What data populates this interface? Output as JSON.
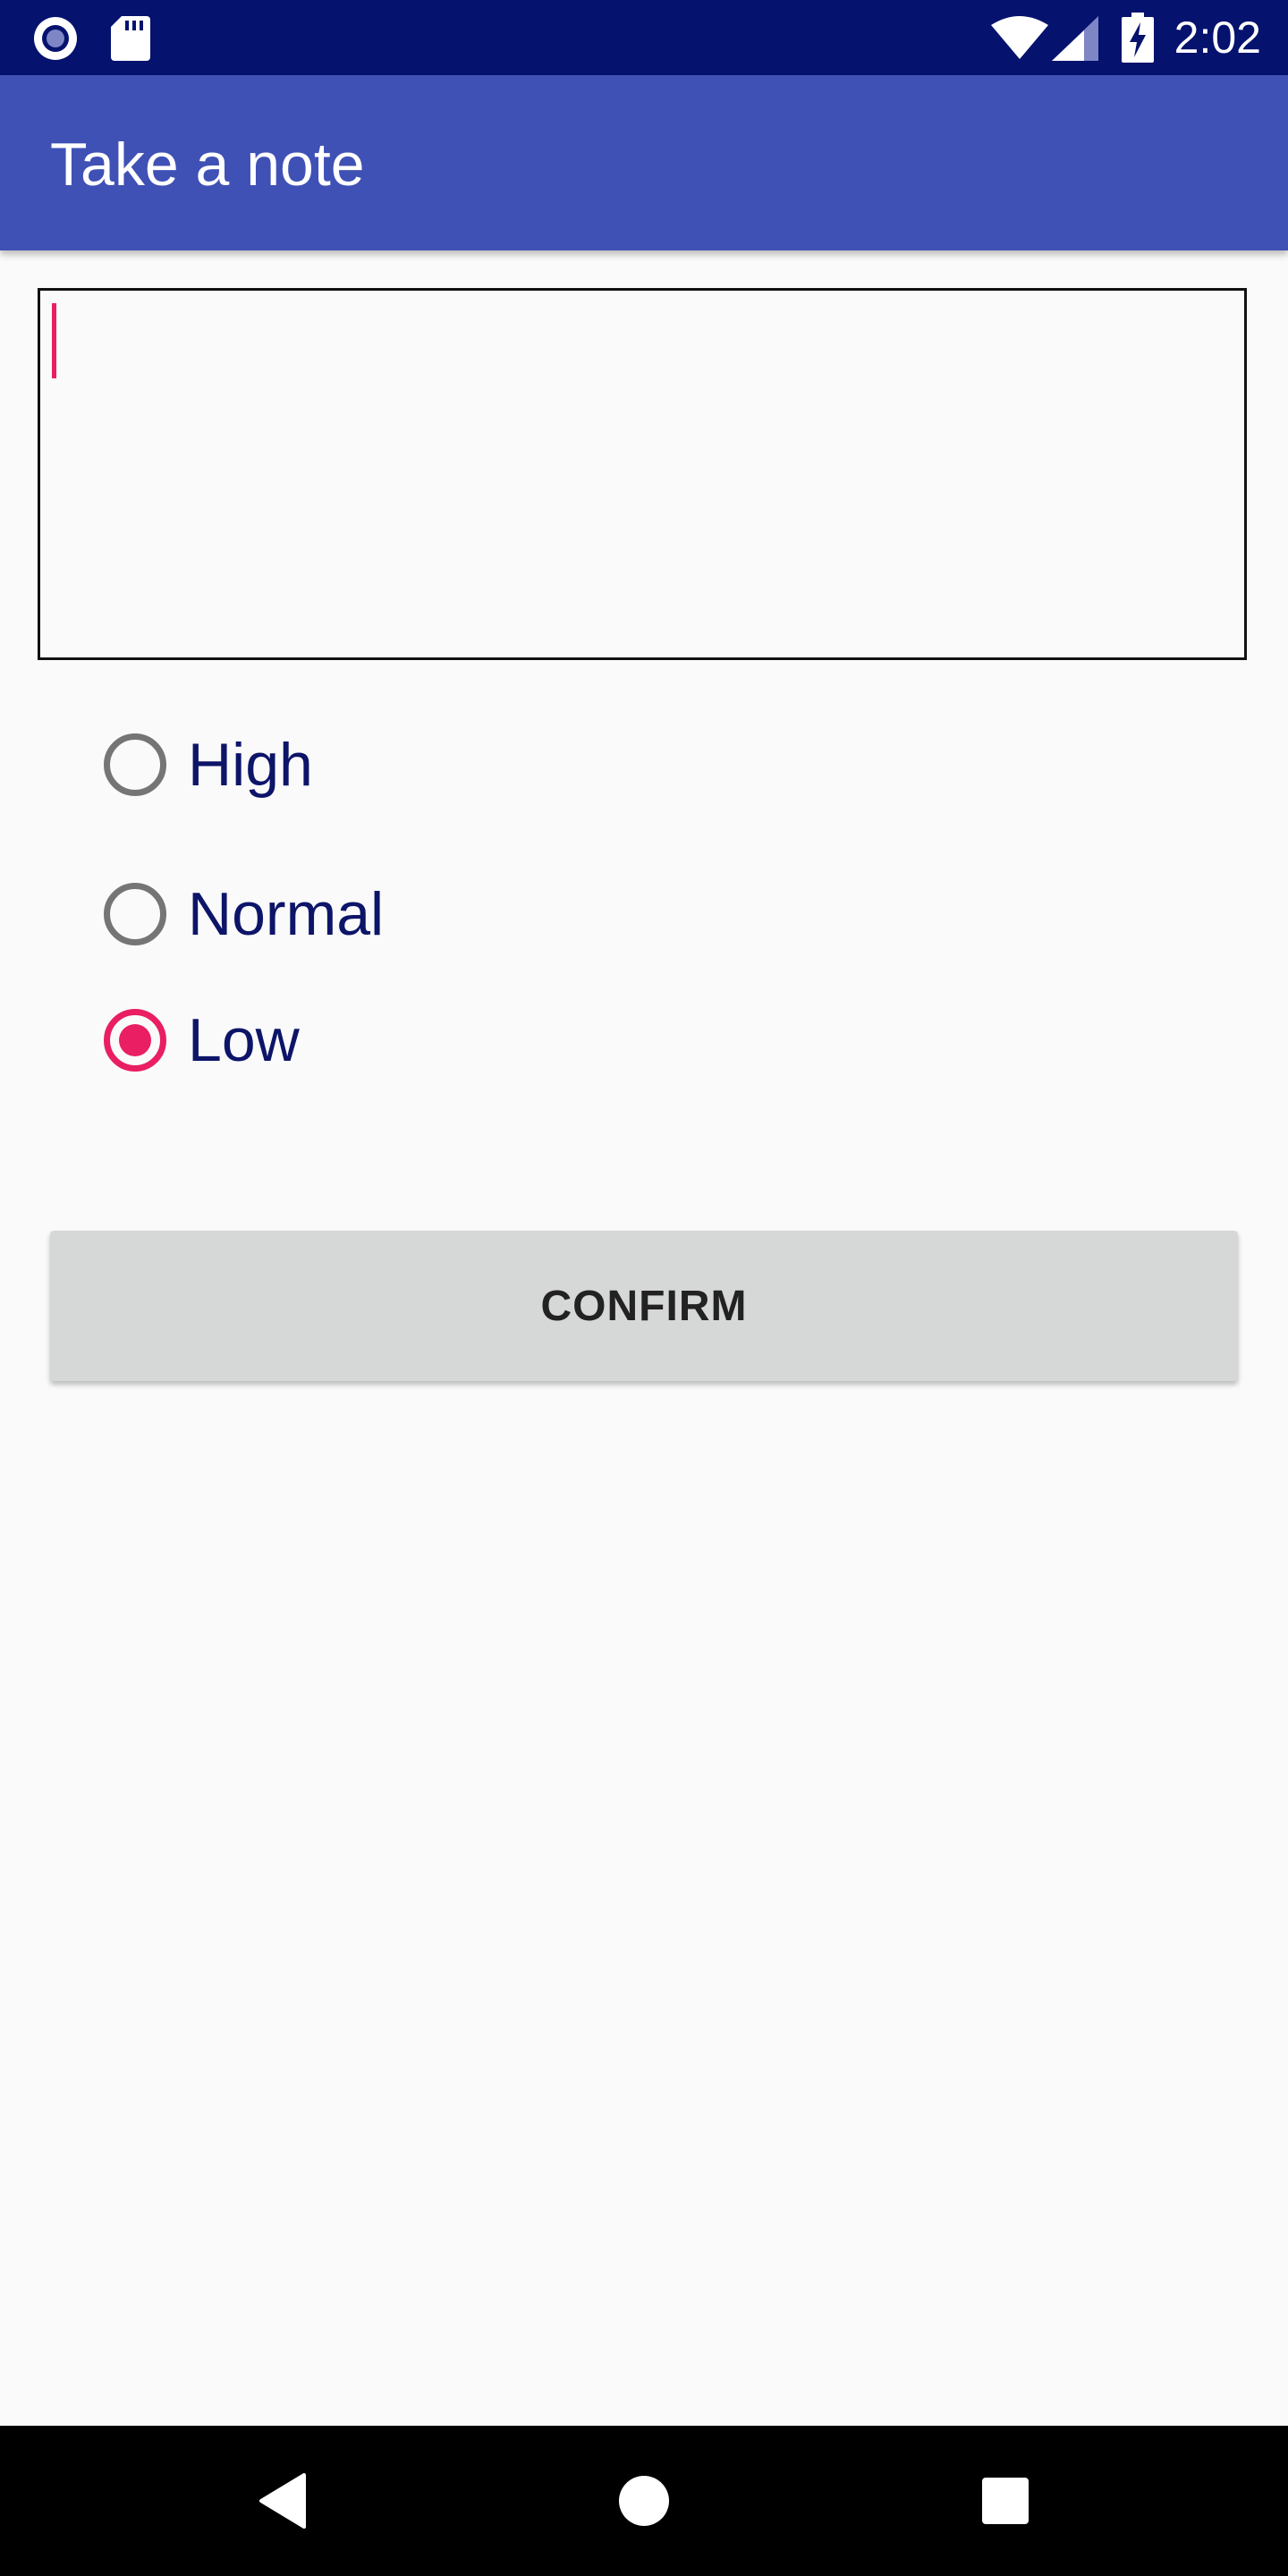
{
  "status_bar": {
    "time": "2:02",
    "left_icons": [
      "record-icon",
      "sd-card-icon"
    ],
    "right_icons": [
      "wifi-icon",
      "cellular-signal-icon",
      "battery-charging-icon"
    ],
    "background_color": "#05126E"
  },
  "app_bar": {
    "title": "Take a note",
    "background_color": "#3F51B5"
  },
  "note_input": {
    "value": "",
    "placeholder": ""
  },
  "priority": {
    "options": [
      {
        "label": "High",
        "checked": false
      },
      {
        "label": "Normal",
        "checked": false
      },
      {
        "label": "Low",
        "checked": true
      }
    ],
    "accent_color": "#E91E63",
    "label_color": "#0D1569"
  },
  "confirm_button": {
    "label": "CONFIRM"
  },
  "nav_bar": {
    "buttons": [
      "back-icon",
      "home-icon",
      "recents-icon"
    ]
  }
}
